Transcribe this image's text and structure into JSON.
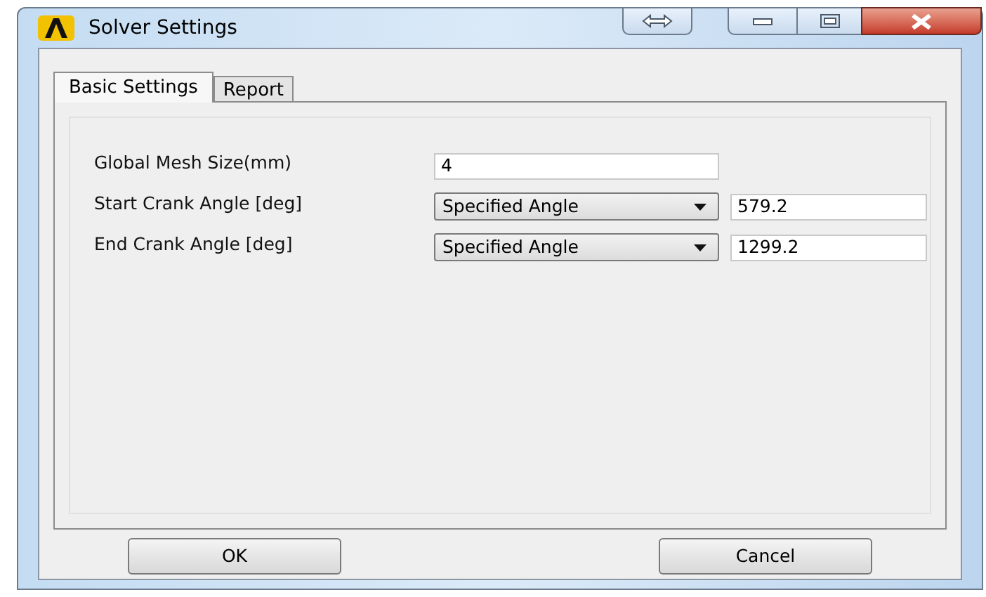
{
  "window": {
    "title": "Solver Settings"
  },
  "tabs": [
    {
      "label": "Basic Settings",
      "selected": true
    },
    {
      "label": "Report",
      "selected": false
    }
  ],
  "fields": [
    {
      "kind": "text",
      "label": "Global Mesh Size(mm)",
      "value": "4"
    },
    {
      "kind": "dropdown",
      "label": "Start Crank Angle [deg]",
      "option": "Specified Angle",
      "value": "579.2"
    },
    {
      "kind": "dropdown",
      "label": "End Crank Angle [deg]",
      "option": "Specified Angle",
      "value": "1299.2"
    }
  ],
  "buttons": [
    "OK",
    "Cancel"
  ]
}
